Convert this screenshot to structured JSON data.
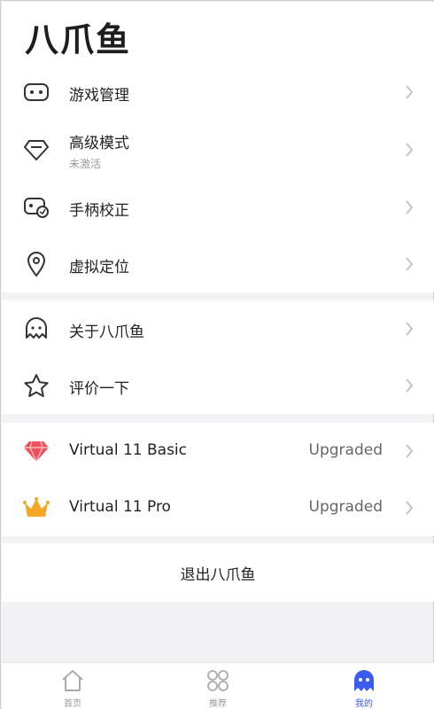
{
  "header": {
    "title": "八爪鱼"
  },
  "group1": {
    "items": [
      {
        "label": "游戏管理",
        "icon": "gamepad-icon"
      },
      {
        "label": "高级模式",
        "sub": "未激活",
        "icon": "diamond-icon"
      },
      {
        "label": "手柄校正",
        "icon": "controller-calibrate-icon"
      },
      {
        "label": "虚拟定位",
        "icon": "location-pin-icon"
      }
    ]
  },
  "group2": {
    "items": [
      {
        "label": "关于八爪鱼",
        "icon": "octopus-icon"
      },
      {
        "label": "评价一下",
        "icon": "star-icon"
      }
    ]
  },
  "group3": {
    "items": [
      {
        "label": "Virtual 11 Basic",
        "status": "Upgraded",
        "icon": "red-gem-icon"
      },
      {
        "label": "Virtual 11 Pro",
        "status": "Upgraded",
        "icon": "gold-crown-icon"
      }
    ]
  },
  "logout": {
    "label": "退出八爪鱼"
  },
  "tabbar": {
    "tabs": [
      {
        "label": "首页",
        "icon": "home-icon"
      },
      {
        "label": "推荐",
        "icon": "grid-icon"
      },
      {
        "label": "我的",
        "icon": "ghost-icon",
        "active": true
      }
    ]
  },
  "colors": {
    "accent": "#3a5df0",
    "gem": "#f0505a",
    "crown": "#f5a623"
  }
}
